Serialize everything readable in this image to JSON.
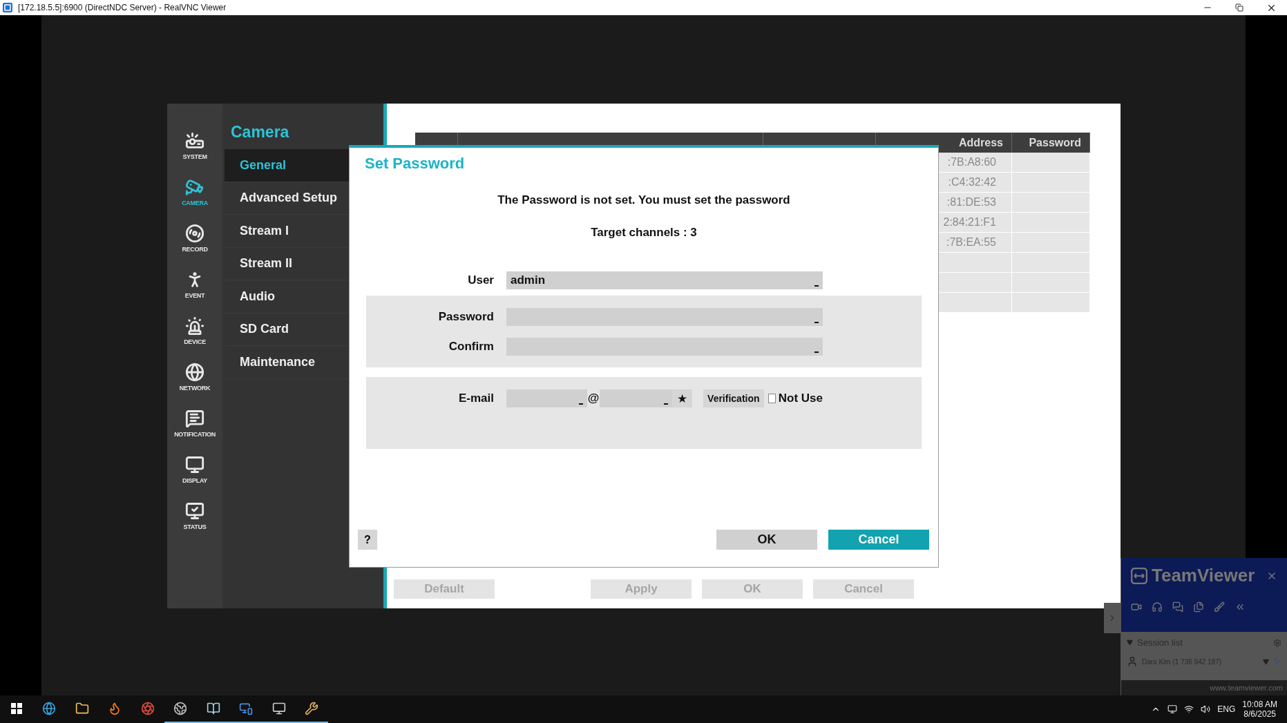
{
  "window": {
    "title": "[172.18.5.5]:6900 (DirectNDC Server) - RealVNC Viewer"
  },
  "dvr": {
    "rail": [
      {
        "label": "SYSTEM",
        "selected": false
      },
      {
        "label": "CAMERA",
        "selected": true
      },
      {
        "label": "RECORD",
        "selected": false
      },
      {
        "label": "EVENT",
        "selected": false
      },
      {
        "label": "DEVICE",
        "selected": false
      },
      {
        "label": "NETWORK",
        "selected": false
      },
      {
        "label": "NOTIFICATION",
        "selected": false
      },
      {
        "label": "DISPLAY",
        "selected": false
      },
      {
        "label": "STATUS",
        "selected": false
      }
    ],
    "menu": {
      "title": "Camera",
      "items": [
        {
          "label": "General",
          "selected": true
        },
        {
          "label": "Advanced Setup",
          "selected": false
        },
        {
          "label": "Stream I",
          "selected": false
        },
        {
          "label": "Stream II",
          "selected": false
        },
        {
          "label": "Audio",
          "selected": false
        },
        {
          "label": "SD Card",
          "selected": false
        },
        {
          "label": "Maintenance",
          "selected": false
        }
      ]
    },
    "table": {
      "columns": [
        {
          "kind": "hidden"
        },
        {
          "kind": "hidden"
        },
        {
          "kind": "hidden"
        },
        {
          "kind": "label",
          "label": "Address"
        },
        {
          "kind": "label",
          "label": "Password"
        }
      ],
      "mac_cells": [
        ":7B:A8:60",
        ":C4:32:42",
        ":81:DE:53",
        "2:84:21:F1",
        ":7B:EA:55"
      ]
    },
    "footer_buttons": [
      {
        "label": "Default",
        "disabled": true
      },
      {
        "label": "Apply",
        "disabled": true
      },
      {
        "label": "OK",
        "disabled": true
      },
      {
        "label": "Cancel",
        "disabled": true
      }
    ]
  },
  "dialog": {
    "title": "Set Password",
    "message": "The Password is not set. You must set the password",
    "target": "Target channels : 3",
    "user": {
      "label": "User",
      "value": "admin"
    },
    "password": {
      "label": "Password"
    },
    "confirm": {
      "label": "Confirm"
    },
    "email": {
      "label": "E-mail",
      "at": "@",
      "domain_button": "★",
      "verify": "Verification",
      "not_use": {
        "label": "Not Use",
        "checked": false
      }
    },
    "help": "?",
    "buttons": [
      {
        "label": "OK",
        "selected": false
      },
      {
        "label": "Cancel",
        "selected": true
      }
    ]
  },
  "teamviewer": {
    "brand": "TeamViewer",
    "session_title": "Session list",
    "sessions": [
      {
        "name": "Dara Kim (1 736 942 187)"
      }
    ],
    "url": "www.teamviewer.com"
  },
  "taskbar": {
    "apps": [
      {
        "running": false
      },
      {
        "running": false
      },
      {
        "running": false
      },
      {
        "running": false
      },
      {
        "running": true
      },
      {
        "running": true
      },
      {
        "running": true
      },
      {
        "running": true
      },
      {
        "running": true
      }
    ],
    "language": "ENG",
    "time": "10:08 AM",
    "date": "8/6/2025"
  }
}
